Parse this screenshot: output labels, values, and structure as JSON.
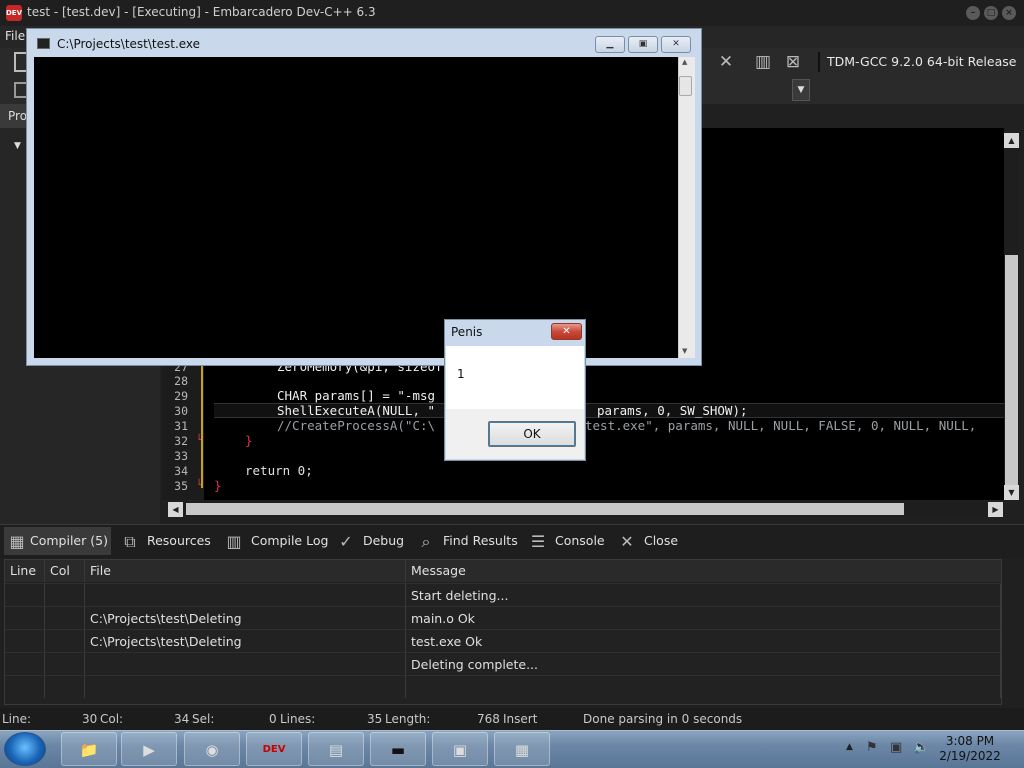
{
  "window": {
    "title": "test - [test.dev] - [Executing] - Embarcadero Dev-C++ 6.3",
    "app_icon": "DEV"
  },
  "menu": {
    "file": "File"
  },
  "toolbar": {
    "compiler": "TDM-GCC 9.2.0 64-bit Release"
  },
  "left_panel": {
    "tab": "Pro"
  },
  "editor": {
    "lines": [
      {
        "num": "27",
        "text": "ZeroMemory(&pi, sizeof"
      },
      {
        "num": "28",
        "text": ""
      },
      {
        "num": "29",
        "text": "CHAR params[] = \"-msg"
      },
      {
        "num": "30",
        "text": "ShellExecuteA(NULL, \"",
        "tail": "params, 0, SW_SHOW);"
      },
      {
        "num": "31",
        "text": "//CreateProcessA(\"C:\\",
        "tail": "test.exe\", params, NULL, NULL, FALSE, 0, NULL, NULL,"
      },
      {
        "num": "32",
        "text": "}"
      },
      {
        "num": "33",
        "text": ""
      },
      {
        "num": "34",
        "text": "return 0;"
      },
      {
        "num": "35",
        "text": "}"
      }
    ]
  },
  "bottom_tabs": [
    {
      "label": "Compiler (5)",
      "icon": "grid-icon"
    },
    {
      "label": "Resources",
      "icon": "copy-icon"
    },
    {
      "label": "Compile Log",
      "icon": "chart-icon"
    },
    {
      "label": "Debug",
      "icon": "check-icon"
    },
    {
      "label": "Find Results",
      "icon": "magnifier-doc-icon"
    },
    {
      "label": "Console",
      "icon": "console-icon"
    },
    {
      "label": "Close",
      "icon": "close-icon"
    }
  ],
  "grid": {
    "columns": [
      "Line",
      "Col",
      "File",
      "Message"
    ],
    "rows": [
      {
        "line": "",
        "col": "",
        "file": "",
        "message": "Start deleting..."
      },
      {
        "line": "",
        "col": "",
        "file": "C:\\Projects\\test\\Deleting",
        "message": "main.o Ok"
      },
      {
        "line": "",
        "col": "",
        "file": "C:\\Projects\\test\\Deleting",
        "message": "test.exe Ok"
      },
      {
        "line": "",
        "col": "",
        "file": "",
        "message": "Deleting complete..."
      },
      {
        "line": "",
        "col": "",
        "file": "",
        "message": ""
      }
    ]
  },
  "status": {
    "line_label": "Line:",
    "line_value": "30",
    "col_label": "Col:",
    "col_value": "34",
    "sel_label": "Sel:",
    "sel_value": "0",
    "lines_label": "Lines:",
    "lines_value": "35",
    "length_label": "Length:",
    "length_value": "768",
    "mode": "Insert",
    "message": "Done parsing in 0 seconds"
  },
  "console_window": {
    "title": "C:\\Projects\\test\\test.exe"
  },
  "message_box": {
    "title": "Penis",
    "text": "1",
    "ok": "OK"
  },
  "taskbar": {
    "time": "3:08 PM",
    "date": "2/19/2022"
  }
}
